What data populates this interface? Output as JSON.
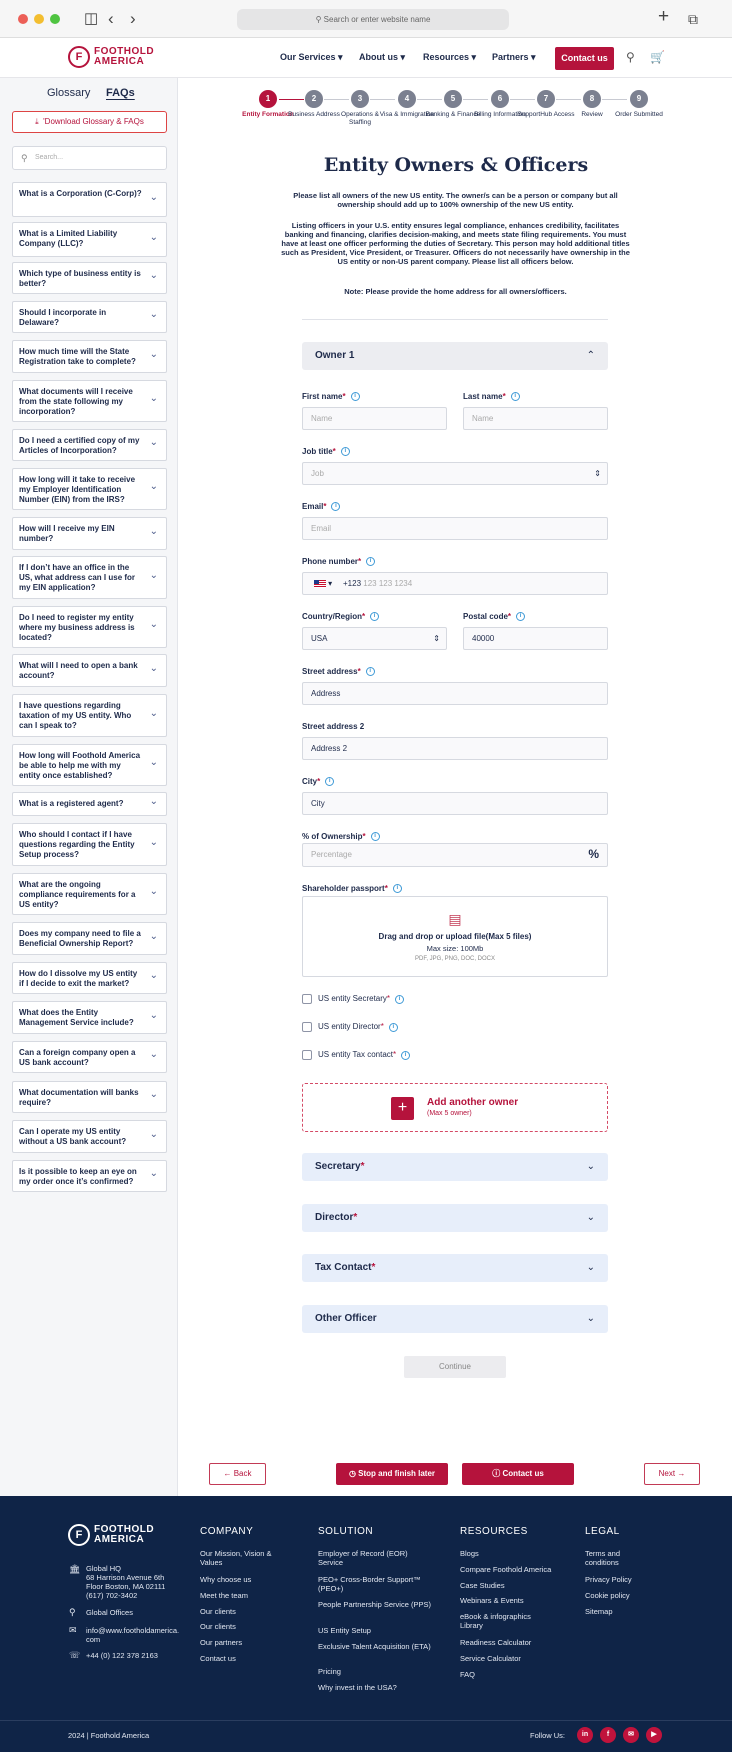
{
  "browser": {
    "url_placeholder": "Search or enter website name"
  },
  "brand": {
    "line1": "FOOTHOLD",
    "line2": "AMERICA",
    "mark": "F",
    "color": "#b5133c"
  },
  "nav": {
    "services": "Our Services",
    "about": "About us",
    "resources": "Resources",
    "partners": "Partners",
    "contact": "Contact us"
  },
  "sidebar": {
    "tabs": [
      "Glossary",
      "FAQs"
    ],
    "active_tab": "FAQs",
    "download": "Download Glossary & FAQs",
    "search_placeholder": "Search...",
    "faqs": [
      "What is a Corporation (C-Corp)?",
      "What is a Limited Liability Company (LLC)?",
      "Which type of business entity is better?",
      "Should I incorporate in Delaware?",
      "How much time will the State Registration take to complete?",
      "What documents will I receive from the state following my incorporation?",
      "Do I need a certified copy of my Articles of Incorporation?",
      "How long will it take to receive my Employer Identification Number (EIN) from the IRS?",
      "How will I receive my EIN number?",
      "If I don’t have an office in the US, what address can I use for my EIN application?",
      "Do I need to register my entity where my business address is located?",
      "What will I need to open a bank account?",
      "I have questions regarding taxation of my US entity. Who can I speak to?",
      "How long will Foothold America be able to help me with my entity once established?",
      "What is a registered agent?",
      "Who should I contact if I have questions regarding the Entity Setup process?",
      "What are the ongoing compliance requirements for a US entity?",
      "Does my company need to file a Beneficial Ownership Report?",
      "How do I dissolve my US entity if I decide to exit the market?",
      "What does the Entity Management Service include?",
      "Can a foreign company open a US bank account?",
      "What documentation will banks require?",
      "Can I operate my US entity without a US bank account?",
      "Is it possible to keep an eye on my order once it’s confirmed?"
    ]
  },
  "stepper": [
    {
      "n": "1",
      "label": "Entity Formation",
      "active": true
    },
    {
      "n": "2",
      "label": "Business Address"
    },
    {
      "n": "3",
      "label": "Operations & Staffing"
    },
    {
      "n": "4",
      "label": "Visa & Immigration"
    },
    {
      "n": "5",
      "label": "Banking & Finance"
    },
    {
      "n": "6",
      "label": "Billing Information"
    },
    {
      "n": "7",
      "label": "SupportHub Access"
    },
    {
      "n": "8",
      "label": "Review"
    },
    {
      "n": "9",
      "label": "Order Submitted"
    }
  ],
  "form": {
    "title": "Entity Owners & Officers",
    "intro1": "Please list all owners of the new US entity. The owner/s can be a person or company but all ownership should add up to 100% ownership of the new US entity.",
    "intro2": "Listing officers in your U.S. entity ensures legal compliance, enhances credibility, facilitates banking and financing, clarifies decision-making, and meets state filing requirements. You must have at least one officer performing the duties of Secretary. This person may hold additional titles such as President, Vice President, or Treasurer. Officers do not necessarily have ownership in the US entity or non-US parent company. Please list all officers below.",
    "note": "Note: Please provide the home address for all owners/officers.",
    "owner_title": "Owner 1",
    "first_name": {
      "label": "First name",
      "placeholder": "Name"
    },
    "last_name": {
      "label": "Last name",
      "placeholder": "Name"
    },
    "job_title": {
      "label": "Job title",
      "placeholder": "Job"
    },
    "email": {
      "label": "Email",
      "placeholder": "Email"
    },
    "phone": {
      "label": "Phone number",
      "code": "+123",
      "placeholder": "123 123 1234"
    },
    "country": {
      "label": "Country/Region",
      "value": "USA"
    },
    "postal": {
      "label": "Postal code",
      "value": "40000"
    },
    "street": {
      "label": "Street address",
      "value": "Address"
    },
    "street2": {
      "label": "Street address 2",
      "value": "Address 2"
    },
    "city": {
      "label": "City",
      "value": "City"
    },
    "ownership": {
      "label": "% of Ownership",
      "placeholder": "Percentage",
      "unit": "%"
    },
    "passport": {
      "label": "Shareholder passport",
      "upload_title": "Drag and drop or upload file(Max 5 files)",
      "max_size": "Max size: 100Mb",
      "formats": "PDF, JPG, PNG, DOC, DOCX"
    },
    "checkboxes": [
      "US entity Secretary",
      "US entity Director",
      "US entity Tax contact"
    ],
    "add_owner": {
      "title": "Add another owner",
      "sub": "(Max 5 owner)"
    },
    "sections": [
      {
        "label": "Secretary",
        "required": true
      },
      {
        "label": "Director",
        "required": false
      },
      {
        "label": "Tax Contact",
        "required": true
      },
      {
        "label": "Other Officer",
        "required": false
      }
    ],
    "continue": "Continue"
  },
  "actions": {
    "back": "Back",
    "stop": "Stop and finish later",
    "contact": "Contact us",
    "next": "Next"
  },
  "footer": {
    "hq_label": "Global HQ",
    "hq_address": "68 Harrison Avenue 6th Floor Boston, MA 02111",
    "hq_phone": "(617) 702-3402",
    "offices": "Global Offices",
    "email": "info@www.footholdamerica.com",
    "phone": "+44 (0) 122 378 2163",
    "company": {
      "title": "COMPANY",
      "links": [
        "Our Mission, Vision & Values",
        "Why choose us",
        "Meet the team",
        "Our clients",
        "Our clients",
        "Our partners",
        "Contact us"
      ]
    },
    "solution": {
      "title": "SOLUTION",
      "links": [
        "Employer of Record (EOR) Service",
        "PEO+ Cross-Border Support™ (PEO+)",
        "People Partnership Service (PPS)",
        "US Entity Setup",
        "Exclusive Talent Acquisition (ETA)",
        "Pricing",
        "Why invest in the USA?"
      ]
    },
    "resources": {
      "title": "RESOURCES",
      "links": [
        "Blogs",
        "Compare Foothold America",
        "Case Studies",
        "Webinars & Events",
        "eBook & infographics Library",
        "Readiness Calculator",
        "Service Calculator",
        "FAQ"
      ]
    },
    "legal": {
      "title": "LEGAL",
      "links": [
        "Terms and conditions",
        "Privacy Policy",
        "Cookie policy",
        "Sitemap"
      ]
    },
    "copyright": "2024 | Foothold America",
    "follow": "Follow Us:"
  }
}
